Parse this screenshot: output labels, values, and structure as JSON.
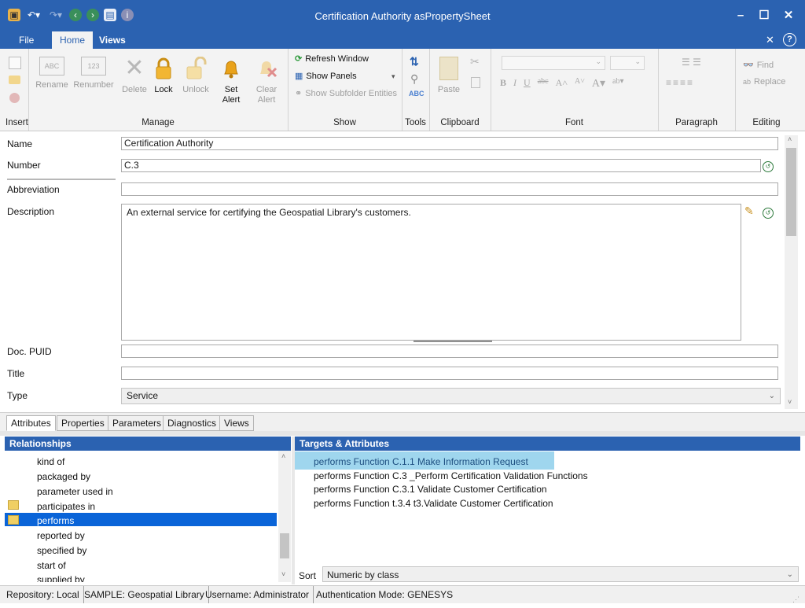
{
  "window": {
    "title": "Certification Authority asPropertySheet"
  },
  "menu": {
    "tabs": [
      "File",
      "Home",
      "Views"
    ]
  },
  "ribbon": {
    "insert_label": "Insert",
    "manage": {
      "label": "Manage",
      "rename": "Rename",
      "renumber": "Renumber",
      "delete": "Delete",
      "lock": "Lock",
      "unlock": "Unlock",
      "set_alert_1": "Set",
      "set_alert_2": "Alert",
      "clear_alert_1": "Clear",
      "clear_alert_2": "Alert",
      "abc": "ABC",
      "num": "123"
    },
    "show": {
      "label": "Show",
      "refresh": "Refresh Window",
      "panels": "Show Panels",
      "subfolder": "Show Subfolder Entities"
    },
    "tools_label": "Tools",
    "clipboard": {
      "label": "Clipboard",
      "paste": "Paste"
    },
    "font_label": "Font",
    "paragraph_label": "Paragraph",
    "editing": {
      "label": "Editing",
      "find": "Find",
      "replace": "Replace"
    }
  },
  "form": {
    "name_label": "Name",
    "name_value": "Certification Authority",
    "number_label": "Number",
    "number_value": "C.3",
    "abbreviation_label": "Abbreviation",
    "abbreviation_value": "",
    "description_label": "Description",
    "description_value": "An external service for certifying the Geospatial Library's customers.",
    "doc_puid_label": "Doc. PUID",
    "title_label": "Title",
    "type_label": "Type",
    "type_value": "Service"
  },
  "property_tabs": [
    "Attributes",
    "Properties",
    "Parameters",
    "Diagnostics",
    "Views"
  ],
  "relationships": {
    "header": "Relationships",
    "items": [
      "kind of",
      "packaged by",
      "parameter used in",
      "participates in",
      "performs",
      "reported by",
      "specified by",
      "start of",
      "supplied by"
    ],
    "selected": "performs"
  },
  "targets": {
    "header": "Targets & Attributes",
    "items": [
      "performs Function C.1.1 Make Information Request",
      "performs Function C.3 _Perform Certification Validation Functions",
      "performs Function C.3.1 Validate Customer Certification",
      "performs Function t.3.4 t3.Validate Customer Certification"
    ],
    "sort_label": "Sort",
    "sort_value": "Numeric by class"
  },
  "status": {
    "repository": "Repository: Local",
    "sample": "SAMPLE: Geospatial Library",
    "username": "Username: Administrator",
    "auth": "Authentication Mode: GENESYS"
  },
  "colors": {
    "accent": "#2b62b1",
    "selection": "#0a64d8",
    "highlight": "#9fd6ee"
  }
}
